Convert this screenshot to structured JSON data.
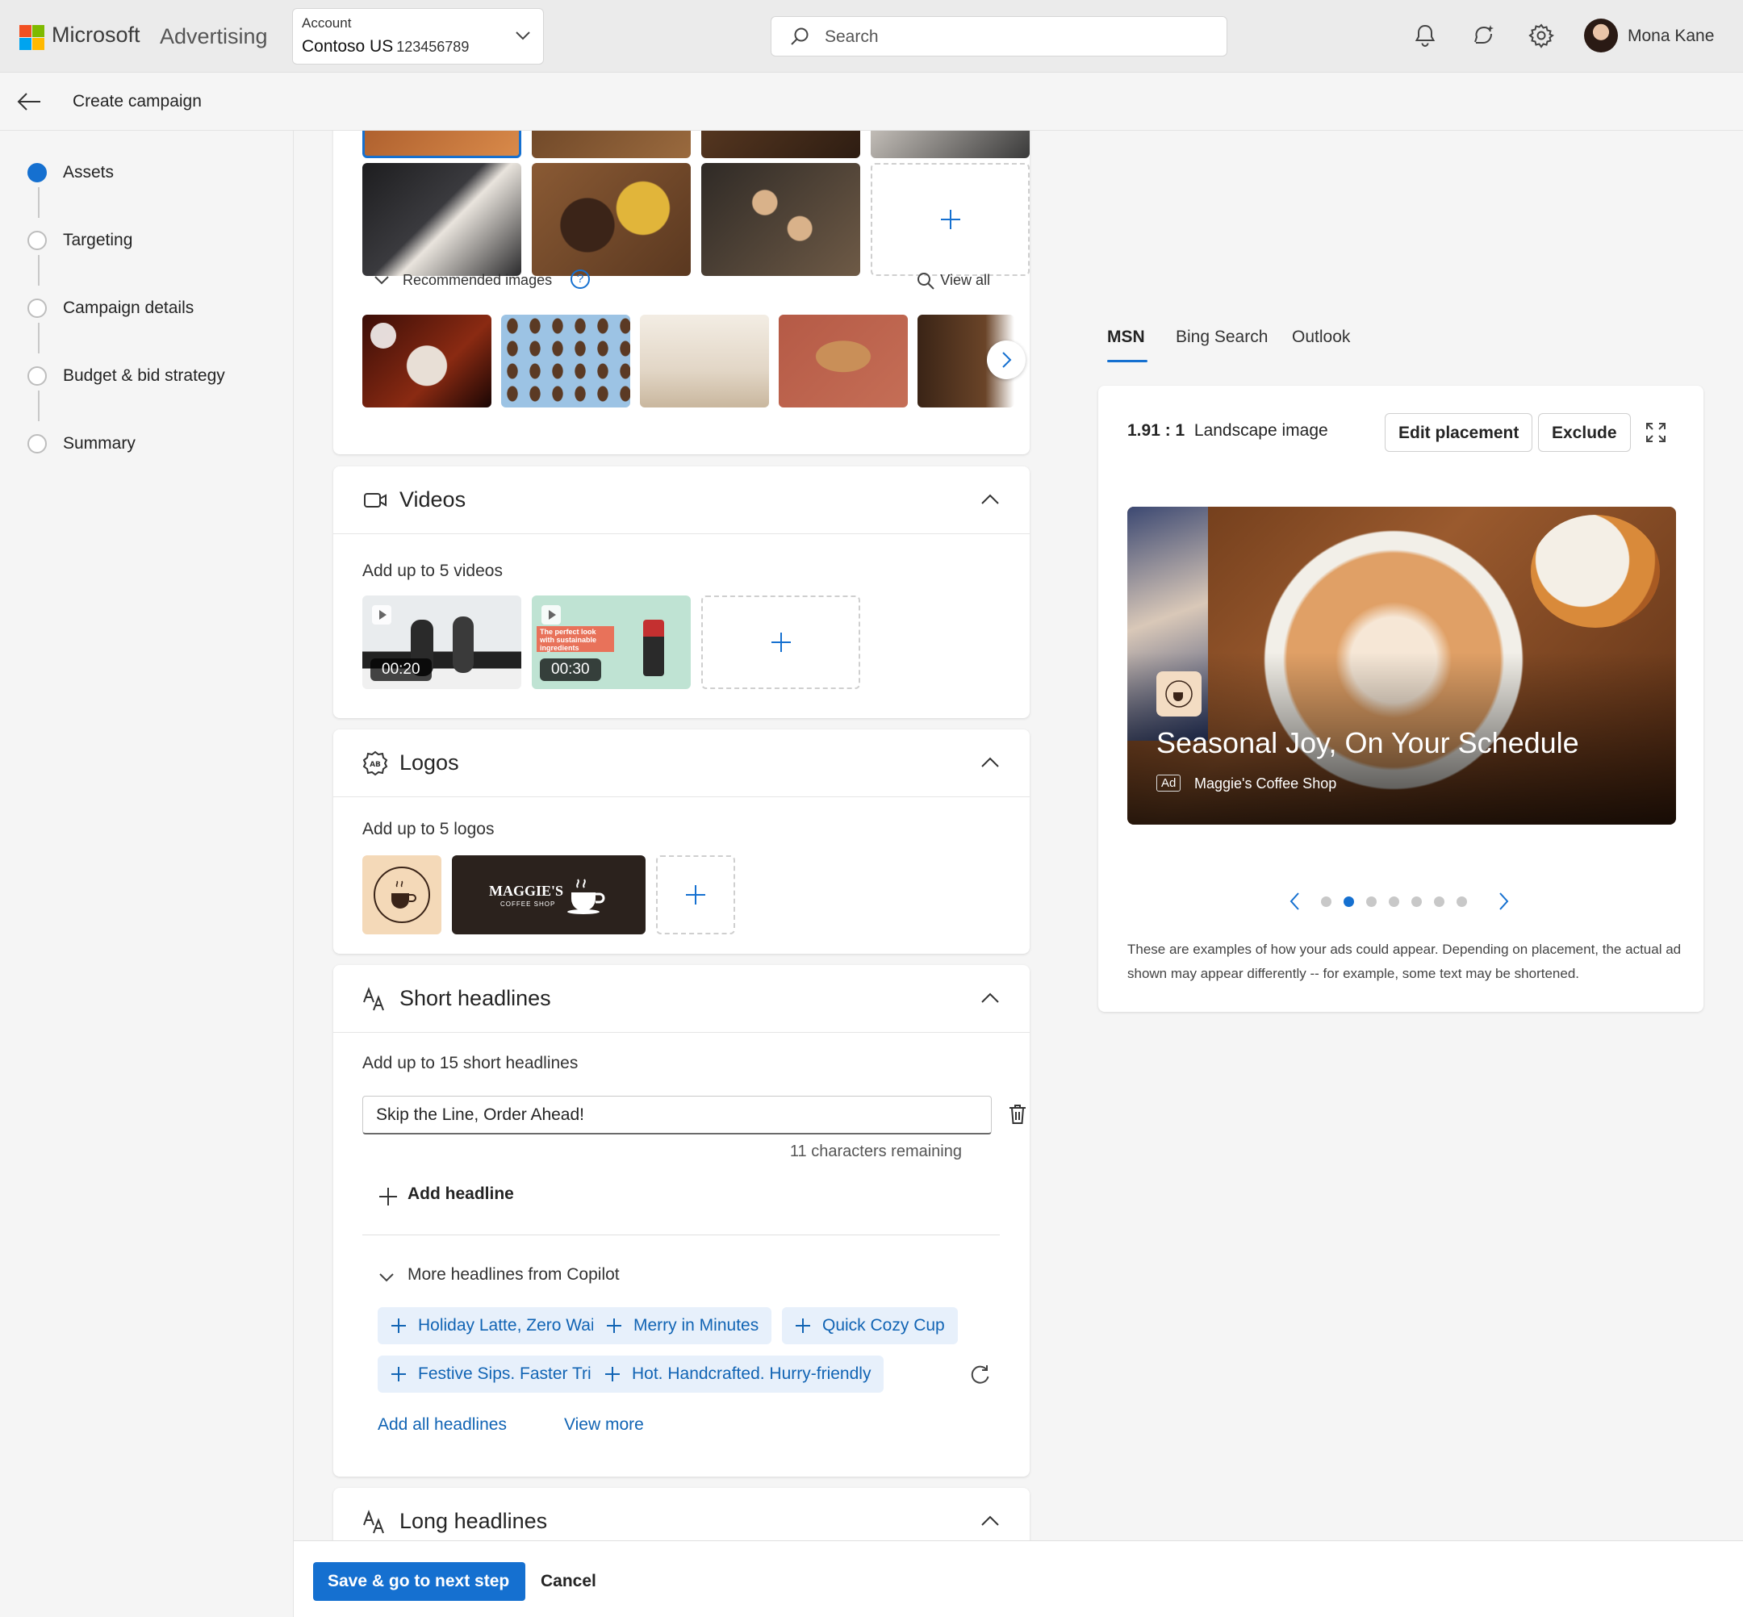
{
  "header": {
    "brand": "Microsoft",
    "brand_sub": "Advertising",
    "account_label": "Account",
    "account_name": "Contoso US",
    "account_number": "123456789",
    "search_placeholder": "Search",
    "user_name": "Mona Kane",
    "icons": [
      "bell-icon",
      "copilot-icon",
      "gear-icon",
      "chevron-down-icon",
      "search-icon"
    ],
    "logo_colors": [
      "#f25022",
      "#7fba00",
      "#00a4ef",
      "#ffb900"
    ]
  },
  "subheader": {
    "title": "Create campaign"
  },
  "steps": [
    {
      "label": "Assets",
      "active": true
    },
    {
      "label": "Targeting",
      "active": false
    },
    {
      "label": "Campaign details",
      "active": false
    },
    {
      "label": "Budget & bid strategy",
      "active": false
    },
    {
      "label": "Summary",
      "active": false
    }
  ],
  "images_section": {
    "recommended_label": "Recommended images",
    "view_all": "View all"
  },
  "videos_section": {
    "title": "Videos",
    "hint": "Add up to 5 videos",
    "videos": [
      {
        "duration": "00:20"
      },
      {
        "duration": "00:30",
        "caption": "The perfect look with sustainable ingredients"
      }
    ]
  },
  "logos_section": {
    "title": "Logos",
    "hint": "Add up to 5 logos",
    "logo_name": "MAGGIE'S",
    "logo_sub": "COFFEE SHOP"
  },
  "short_headlines": {
    "title": "Short headlines",
    "hint": "Add up to 15 short headlines",
    "value": "Skip the Line, Order Ahead!",
    "remaining": "11 characters remaining",
    "add_label": "Add headline",
    "copilot_label": "More headlines from Copilot",
    "suggestions": [
      "Holiday Latte, Zero Wait",
      "Merry in Minutes",
      "Quick Cozy Cup",
      "Festive Sips. Faster Trips",
      "Hot. Handcrafted. Hurry-friendly"
    ],
    "add_all": "Add all headlines",
    "view_more": "View more"
  },
  "long_headlines": {
    "title": "Long headlines"
  },
  "preview": {
    "tabs": [
      "MSN",
      "Bing Search",
      "Outlook"
    ],
    "active_tab": "MSN",
    "ratio": "1.91 : 1",
    "ratio_label": "Landscape image",
    "edit_placement": "Edit placement",
    "exclude": "Exclude",
    "ad_headline": "Seasonal Joy, On Your Schedule",
    "ad_badge": "Ad",
    "ad_brand": "Maggie's Coffee Shop",
    "page_count": 7,
    "active_page": 2,
    "disclaimer": "These are examples of how your ads could appear. Depending on placement, the actual ad shown may appear differently -- for example, some text may be shortened."
  },
  "footer": {
    "primary": "Save & go to next step",
    "cancel": "Cancel"
  },
  "colors": {
    "accent": "#1570d0",
    "link": "#1164b4",
    "chip_bg": "#e7f0fb"
  }
}
